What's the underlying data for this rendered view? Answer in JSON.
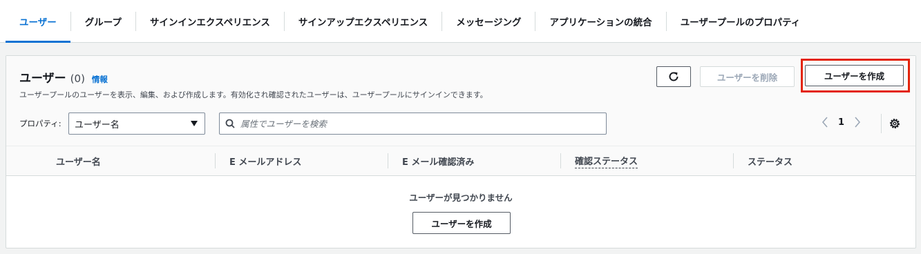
{
  "tabs": [
    {
      "label": "ユーザー",
      "active": true
    },
    {
      "label": "グループ",
      "active": false
    },
    {
      "label": "サインインエクスペリエンス",
      "active": false
    },
    {
      "label": "サインアップエクスペリエンス",
      "active": false
    },
    {
      "label": "メッセージング",
      "active": false
    },
    {
      "label": "アプリケーションの統合",
      "active": false
    },
    {
      "label": "ユーザープールのプロパティ",
      "active": false
    }
  ],
  "header": {
    "title": "ユーザー",
    "count": "(0)",
    "info": "情報",
    "description": "ユーザープールのユーザーを表示、編集、および作成します。有効化され確認されたユーザーは、ユーザープールにサインインできます。"
  },
  "actions": {
    "refresh_icon": "refresh-icon",
    "delete_label": "ユーザーを削除",
    "create_label": "ユーザーを作成"
  },
  "filter": {
    "property_label": "プロパティ:",
    "property_value": "ユーザー名",
    "search_placeholder": "属性でユーザーを検索"
  },
  "pagination": {
    "current_page": "1"
  },
  "table": {
    "columns": [
      "ユーザー名",
      "E メールアドレス",
      "E メール確認済み",
      "確認ステータス",
      "ステータス"
    ],
    "empty_text": "ユーザーが見つかりません",
    "empty_create_label": "ユーザーを作成"
  },
  "colors": {
    "accent": "#0972d3",
    "highlight": "#e3230b"
  }
}
